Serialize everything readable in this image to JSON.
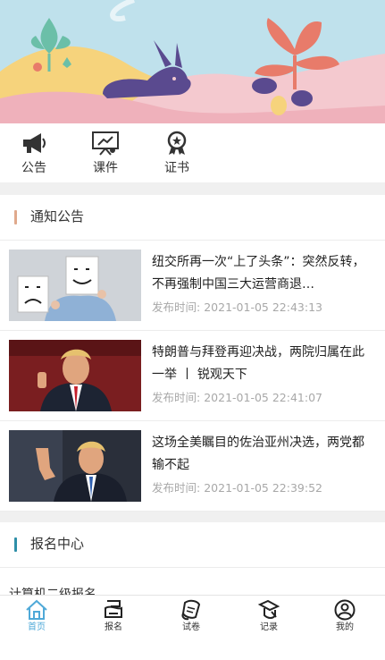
{
  "quick_links": [
    {
      "label": "公告",
      "icon": "megaphone-icon"
    },
    {
      "label": "课件",
      "icon": "courseware-icon"
    },
    {
      "label": "证书",
      "icon": "certificate-icon"
    }
  ],
  "notice_section": {
    "title": "通知公告",
    "accent": "#e0a98c"
  },
  "news": [
    {
      "headline": "纽交所再一次“上了头条”：突然反转，不再强制中国三大运营商退…",
      "time_label": "发布时间:",
      "time": "2021-01-05 22:43:13"
    },
    {
      "headline": "特朗普与拜登再迎决战，两院归属在此一举 丨 锐观天下",
      "time_label": "发布时间:",
      "time": "2021-01-05 22:41:07"
    },
    {
      "headline": "这场全美瞩目的佐治亚州决选，两党都输不起",
      "time_label": "发布时间:",
      "time": "2021-01-05 22:39:52"
    }
  ],
  "signup_section": {
    "title": "报名中心",
    "accent": "#2e8fa8"
  },
  "partial_item": "计算机二级报名",
  "tabbar": {
    "active_color": "#4fa9d8",
    "items": [
      {
        "label": "首页",
        "icon": "home-icon",
        "active": true
      },
      {
        "label": "报名",
        "icon": "signup-icon",
        "active": false
      },
      {
        "label": "试卷",
        "icon": "exam-paper-icon",
        "active": false
      },
      {
        "label": "记录",
        "icon": "record-icon",
        "active": false
      },
      {
        "label": "我的",
        "icon": "profile-icon",
        "active": false
      }
    ]
  }
}
